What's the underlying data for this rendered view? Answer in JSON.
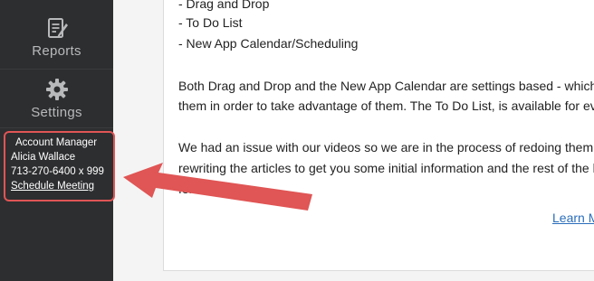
{
  "sidebar": {
    "items": [
      {
        "label": "Reports",
        "icon": "report-icon"
      },
      {
        "label": "Settings",
        "icon": "gear-icon"
      }
    ],
    "account_manager": {
      "title": "Account Manager",
      "name": "Alicia Wallace",
      "phone": "713-270-6400 x 999",
      "link": "Schedule Meeting"
    }
  },
  "content": {
    "list_items": [
      "- Drag and Drop",
      "- To Do List",
      "- New App Calendar/Scheduling"
    ],
    "paragraph1": [
      "Both Drag and Drop and the New App Calendar are settings based - which m",
      "them in order to take advantage of them. The To Do List, is available for ever"
    ],
    "paragraph2": [
      "We had an issue with our videos so we are in the process of redoing them. As",
      "rewriting the articles to get you some initial information and the rest of the h",
      "for this along."
    ],
    "learn_link": "Learn M"
  },
  "colors": {
    "sidebar_bg": "#2d2e30",
    "annotation": "#e05555",
    "link": "#2a6ebb"
  }
}
